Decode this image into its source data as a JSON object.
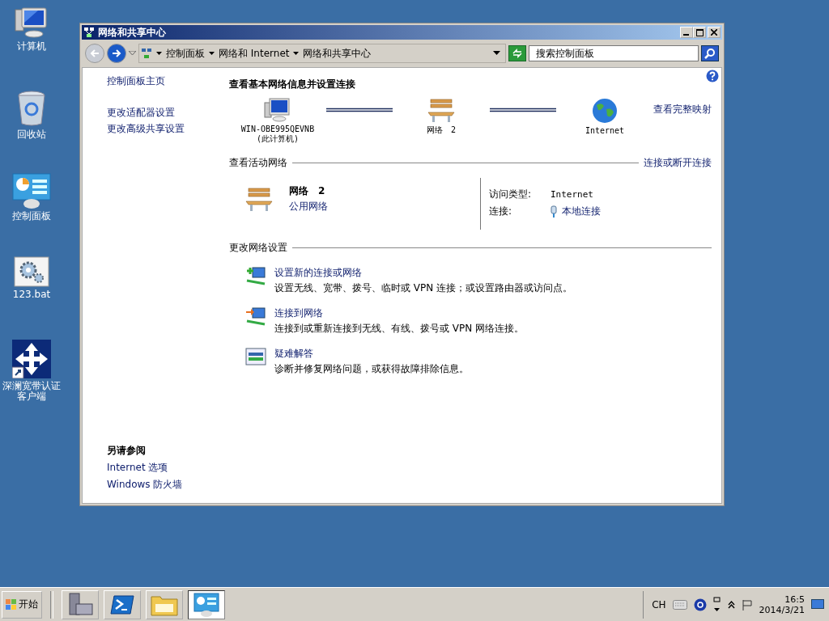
{
  "desktop_icons": [
    {
      "kind": "computer",
      "label": "计算机"
    },
    {
      "kind": "recycle",
      "label": "回收站"
    },
    {
      "kind": "control",
      "label": "控制面板"
    },
    {
      "kind": "gear",
      "label": "123.bat"
    },
    {
      "kind": "shortcut",
      "label": "深澜宽带认证客户端"
    }
  ],
  "window": {
    "title": "网络和共享中心",
    "breadcrumb": [
      "控制面板",
      "网络和 Internet",
      "网络和共享中心"
    ],
    "search": {
      "placeholder": "搜索控制面板"
    },
    "sidebar": {
      "links": [
        "控制面板主页",
        "更改适配器设置",
        "更改高级共享设置"
      ],
      "see_also": {
        "title": "另请参阅",
        "links": [
          "Internet 选项",
          "Windows 防火墙"
        ]
      }
    },
    "main": {
      "title": "查看基本网络信息并设置连接",
      "full_map_link": "查看完整映射",
      "map_nodes": [
        {
          "kind": "computer",
          "label": "WIN-OBE995QEVNB",
          "sublabel": "(此计算机)"
        },
        {
          "kind": "network",
          "label": "网络　2"
        },
        {
          "kind": "internet",
          "label": "Internet"
        }
      ],
      "active": {
        "heading": "查看活动网络",
        "action_link": "连接或断开连接",
        "network_name": "网络　2",
        "network_type": "公用网络",
        "access_label": "访问类型:",
        "access_value": "Internet",
        "connection_label": "连接:",
        "connection_value": "本地连接"
      },
      "change": {
        "heading": "更改网络设置",
        "tasks": [
          {
            "kind": "add",
            "title": "设置新的连接或网络",
            "description": "设置无线、宽带、拨号、临时或 VPN 连接；或设置路由器或访问点。"
          },
          {
            "kind": "connect",
            "title": "连接到网络",
            "description": "连接到或重新连接到无线、有线、拨号或 VPN 网络连接。"
          },
          {
            "kind": "troubleshoot",
            "title": "疑难解答",
            "description": "诊断并修复网络问题，或获得故障排除信息。"
          }
        ]
      }
    }
  },
  "taskbar": {
    "start": "开始",
    "apps": [
      {
        "kind": "server",
        "selected": false
      },
      {
        "kind": "shell",
        "selected": false
      },
      {
        "kind": "folder",
        "selected": false
      },
      {
        "kind": "control",
        "selected": true
      }
    ],
    "tray": {
      "language": "CH",
      "time": "16:5",
      "date": "2014/3/21"
    }
  }
}
